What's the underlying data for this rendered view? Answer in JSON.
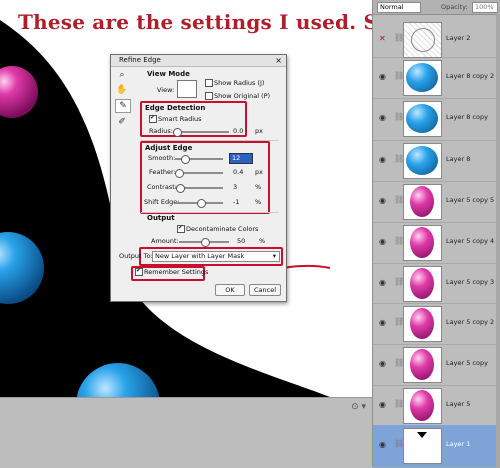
{
  "caption": "These are the settings I used. See text.",
  "dialog": {
    "title": "Refine Edge",
    "close": "×",
    "view_mode": {
      "heading": "View Mode",
      "view_label": "View:",
      "show_radius": "Show Radius (J)",
      "show_original": "Show Original (P)"
    },
    "edge_detection": {
      "heading": "Edge Detection",
      "smart_radius": "Smart Radius",
      "radius_label": "Radius:",
      "radius_value": "0.0",
      "radius_unit": "px"
    },
    "adjust_edge": {
      "heading": "Adjust Edge",
      "smooth_label": "Smooth:",
      "smooth_value": "12",
      "feather_label": "Feather:",
      "feather_value": "0.4",
      "feather_unit": "px",
      "contrast_label": "Contrast:",
      "contrast_value": "3",
      "contrast_unit": "%",
      "shift_label": "Shift Edge:",
      "shift_value": "-1",
      "shift_unit": "%"
    },
    "output": {
      "heading": "Output",
      "decontaminate": "Decontaminate Colors",
      "amount_label": "Amount:",
      "amount_value": "50",
      "amount_unit": "%",
      "output_to_label": "Output To:",
      "output_to_value": "New Layer with Layer Mask"
    },
    "remember": "Remember Settings",
    "ok": "OK",
    "cancel": "Cancel"
  },
  "layers_panel": {
    "blend_mode": "Normal",
    "opacity_label": "Opacity:",
    "opacity_value": "100%",
    "layers": [
      {
        "name": "Layer 2",
        "thumb": "mosaic"
      },
      {
        "name": "Layer 8 copy 2",
        "thumb": "blue"
      },
      {
        "name": "Layer 8 copy",
        "thumb": "blue"
      },
      {
        "name": "Layer 8",
        "thumb": "blue"
      },
      {
        "name": "Layer 5 copy 5",
        "thumb": "pink"
      },
      {
        "name": "Layer 5 copy 4",
        "thumb": "pink"
      },
      {
        "name": "Layer 5 copy 3",
        "thumb": "pink"
      },
      {
        "name": "Layer 5 copy 2",
        "thumb": "pink"
      },
      {
        "name": "Layer 5 copy",
        "thumb": "pink"
      },
      {
        "name": "Layer 5",
        "thumb": "pink"
      },
      {
        "name": "Layer 1",
        "thumb": "mask"
      }
    ]
  },
  "colors": {
    "annotation_red": "#c8102e",
    "selected_layer": "#7ea3d8",
    "blue_ball": "#1f8fd8",
    "pink_ball": "#e03aa8"
  }
}
